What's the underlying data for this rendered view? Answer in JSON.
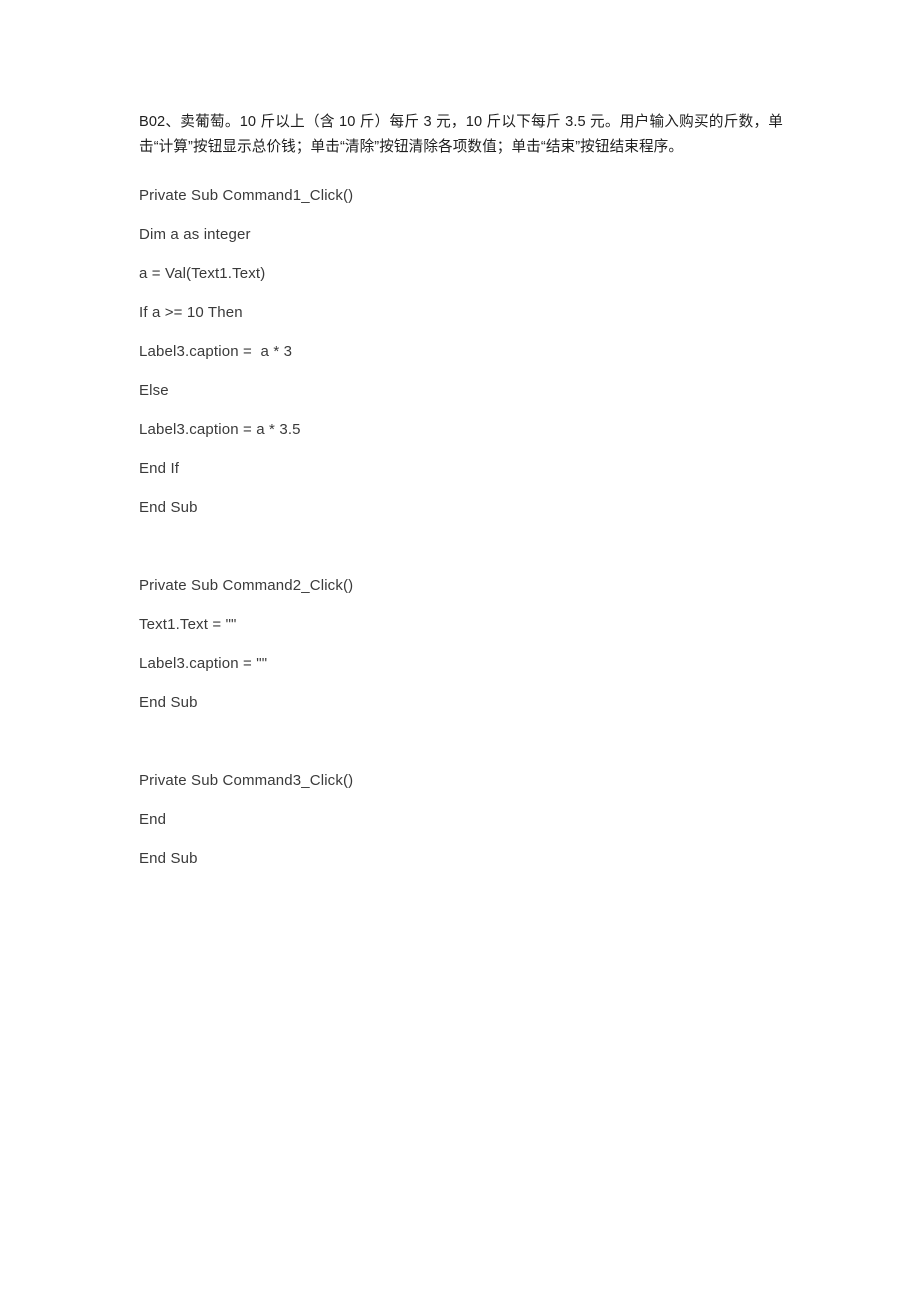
{
  "document": {
    "page_background": "#ffffff",
    "text_color": "#2b2b2b",
    "prompt": {
      "label": "B02",
      "full_text": "B02、卖葡萄。10 斤以上（含 10 斤）每斤 3 元，10 斤以下每斤 3.5 元。用户输入购买的斤数，单击“计算”按钮显示总价钱；单击“清除”按钮清除各项数值；单击“结束”按钮结束程序。",
      "segments": [
        {
          "text": "B02",
          "bold": true
        },
        {
          "text": "、卖葡萄。",
          "bold": true
        },
        {
          "text": "10",
          "bold": true
        },
        {
          "text": " 斤以上（含 ",
          "bold": true
        },
        {
          "text": "10",
          "bold": true
        },
        {
          "text": " 斤）每斤 ",
          "bold": true
        },
        {
          "text": "3",
          "bold": true
        },
        {
          "text": " 元，",
          "bold": true
        },
        {
          "text": "10",
          "bold": true
        },
        {
          "text": " 斤以下每斤 ",
          "bold": true
        },
        {
          "text": "3.5",
          "bold": true
        },
        {
          "text": " 元。用户输入购买的斤数，单击“计算”按钮显示总价钱；单击“清除”按钮清除各项数值；单击“结束”按钮结束程序。",
          "bold": true
        }
      ]
    },
    "code_blocks": [
      {
        "name": "command1-click-handler",
        "lines": [
          "Private Sub Command1_Click()",
          "Dim a as integer",
          "a = Val(Text1.Text)",
          "If a >= 10 Then",
          "Label3.caption =  a * 3",
          "Else",
          "Label3.caption = a * 3.5",
          "End If",
          "End Sub"
        ]
      },
      {
        "name": "command2-click-handler",
        "lines": [
          "Private Sub Command2_Click()",
          "Text1.Text = \"\"",
          "Label3.caption = \"\"",
          "End Sub"
        ]
      },
      {
        "name": "command3-click-handler",
        "lines": [
          "Private Sub Command3_Click()",
          "End",
          "End Sub"
        ]
      }
    ]
  }
}
